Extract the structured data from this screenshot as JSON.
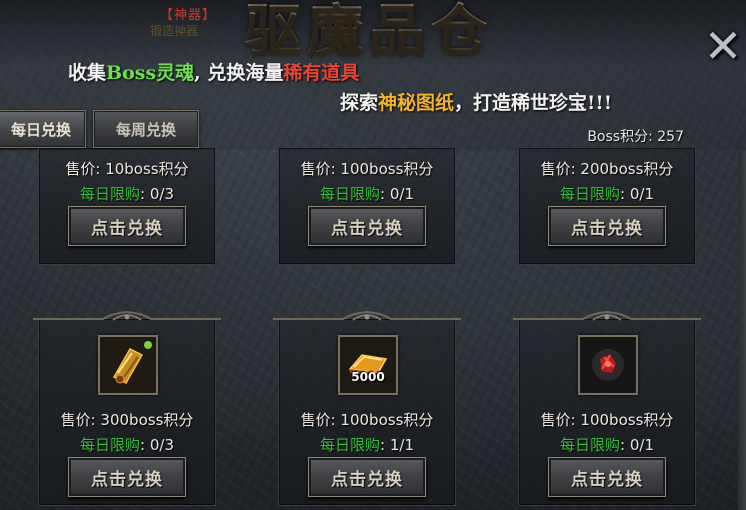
{
  "header": {
    "tag": "【神器】",
    "tag_ghost": "锻造神器",
    "title": "驱魔品仓",
    "slogan_line1": {
      "part1": "收集",
      "part2": "Boss灵魂",
      "part3": ", 兑换海量",
      "part4": "稀有道具"
    },
    "slogan_line2": {
      "part1": "探索",
      "part2": "神秘图纸",
      "part3": "，打造稀世珍宝!!!"
    },
    "close_glyph": "✕"
  },
  "tabs": [
    {
      "label": "每日兑换",
      "active": true
    },
    {
      "label": "每周兑换",
      "active": false
    }
  ],
  "score": {
    "label": "Boss积分:",
    "value": "257"
  },
  "items": [
    {
      "price": "售价: 10boss积分",
      "limit_label": "每日限购",
      "limit_sep": ":",
      "limit_value": "0/3",
      "button": "点击兑换"
    },
    {
      "price": "售价: 100boss积分",
      "limit_label": "每日限购",
      "limit_sep": ":",
      "limit_value": "0/1",
      "button": "点击兑换"
    },
    {
      "price": "售价: 200boss积分",
      "limit_label": "每日限购",
      "limit_sep": ":",
      "limit_value": "0/1",
      "button": "点击兑换"
    },
    {
      "icon": "scroll-icon",
      "price": "售价: 300boss积分",
      "limit_label": "每日限购",
      "limit_sep": ":",
      "limit_value": "0/3",
      "button": "点击兑换"
    },
    {
      "icon": "gold-ingot-icon",
      "qty": "5000",
      "price": "售价: 100boss积分",
      "limit_label": "每日限购",
      "limit_sep": ":",
      "limit_value": "1/1",
      "button": "点击兑换"
    },
    {
      "icon": "red-soul-icon",
      "price": "售价: 100boss积分",
      "limit_label": "每日限购",
      "limit_sep": ":",
      "limit_value": "0/1",
      "button": "点击兑换"
    }
  ],
  "colors": {
    "limit_label": "#36c23a",
    "slogan_green": "#6ee04a",
    "slogan_red": "#e84430",
    "slogan_yellow": "#f2b322"
  }
}
